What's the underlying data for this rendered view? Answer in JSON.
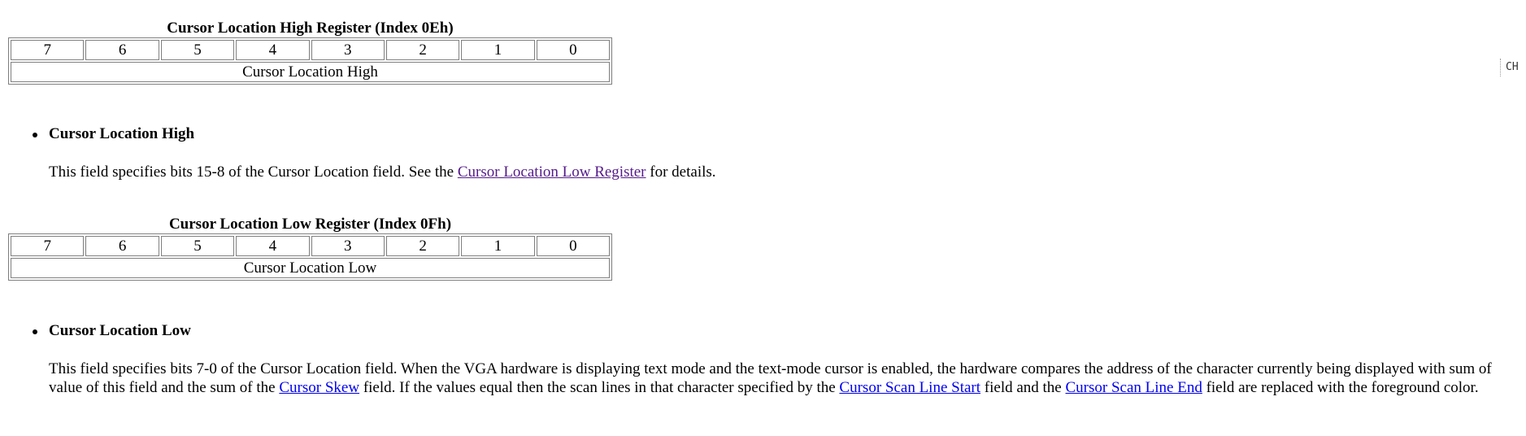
{
  "high_register": {
    "caption": "Cursor Location High Register (Index 0Eh)",
    "bits": [
      "7",
      "6",
      "5",
      "4",
      "3",
      "2",
      "1",
      "0"
    ],
    "field_label": "Cursor Location High"
  },
  "high_field": {
    "name": "Cursor Location High",
    "text_before": "This field specifies bits 15-8 of the Cursor Location field. See the ",
    "link_label": "Cursor Location Low Register",
    "text_after": " for details."
  },
  "low_register": {
    "caption": "Cursor Location Low Register (Index 0Fh)",
    "bits": [
      "7",
      "6",
      "5",
      "4",
      "3",
      "2",
      "1",
      "0"
    ],
    "field_label": "Cursor Location Low"
  },
  "low_field": {
    "name": "Cursor Location Low",
    "text_1": "This field specifies bits 7-0 of the Cursor Location field. When the VGA hardware is displaying text mode and the text-mode cursor is enabled, the hardware compares the address of the character currently being displayed with sum of value of this field and the sum of the ",
    "link_skew": "Cursor Skew",
    "text_2": " field. If the values equal then the scan lines in that character specified by the ",
    "link_start": "Cursor Scan Line Start",
    "text_3": " field and the ",
    "link_end": "Cursor Scan Line End",
    "text_4": " field are replaced with the foreground color."
  },
  "side_tag": "CH"
}
